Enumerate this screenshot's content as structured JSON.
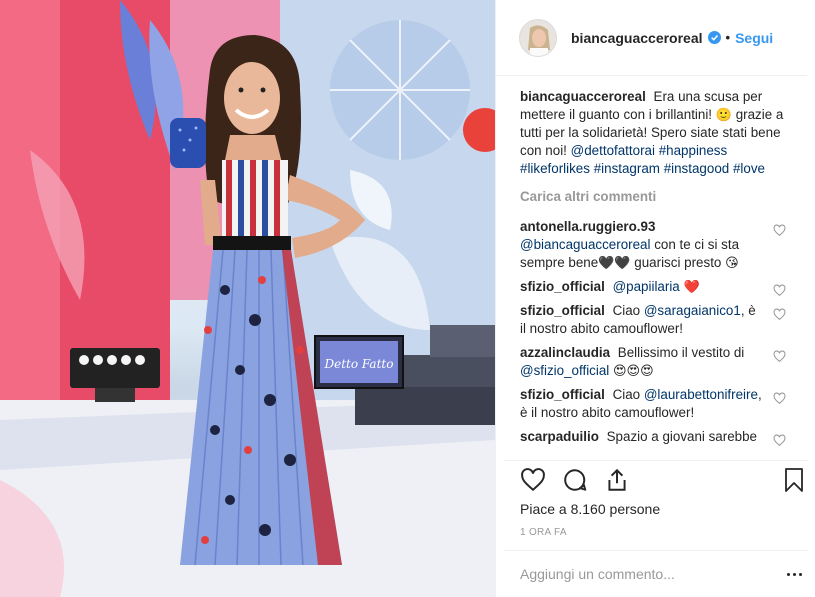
{
  "post": {
    "author": "biancaguacceroreal",
    "verified_icon": "verified-badge-icon",
    "follow_label": "Segui",
    "separator": "•",
    "photo_sign_text": "Detto Fatto"
  },
  "caption": {
    "username": "biancaguacceroreal",
    "text_1": "Era una scusa per mettere il guanto con i brillantini!",
    "emoji_1": "🙂",
    "text_2": "grazie a tutti per la solidarietà! Spero siate stati bene con noi!",
    "mention": "@dettofattorai",
    "hashtags": [
      "#happiness",
      "#likeforlikes",
      "#instagram",
      "#instagood",
      "#love"
    ]
  },
  "load_more_label": "Carica altri commenti",
  "comments": [
    {
      "username": "antonella.ruggiero.93",
      "mention": "@biancaguacceroreal",
      "text": "con te ci si sta sempre bene",
      "emojis": "🖤🖤",
      "text_after": "guarisci presto",
      "emoji_end": "😘"
    },
    {
      "username": "sfizio_official",
      "mention": "@papiilaria",
      "text": "",
      "emoji_end": "❤️"
    },
    {
      "username": "sfizio_official",
      "text_before": "Ciao",
      "mention": "@saragaianico1",
      "text": ", è il nostro abito camouflower!"
    },
    {
      "username": "azzalinclaudia",
      "text_before": "Bellissimo il vestito di",
      "mention": "@sfizio_official",
      "emojis": "😍😍😍"
    },
    {
      "username": "sfizio_official",
      "text_before": "Ciao",
      "mention": "@laurabettonifreire",
      "text": ", è il nostro abito camouflower!"
    },
    {
      "username": "scarpaduilio",
      "text_before": "Spazio a giovani sarebbe"
    }
  ],
  "likes": {
    "prefix": "Piace a",
    "count": "8.160",
    "suffix": "persone"
  },
  "timestamp": "1 ORA FA",
  "add_comment": {
    "placeholder": "Aggiungi un commento..."
  }
}
